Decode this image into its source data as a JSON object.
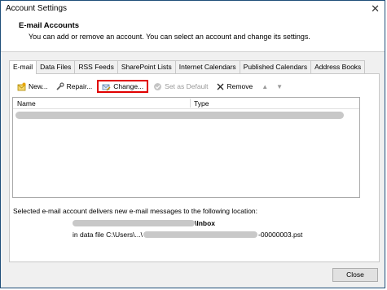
{
  "window": {
    "title": "Account Settings",
    "close_glyph": "✕"
  },
  "header": {
    "title": "E-mail Accounts",
    "subtitle": "You can add or remove an account. You can select an account and change its settings."
  },
  "tabs": [
    {
      "label": "E-mail",
      "active": true
    },
    {
      "label": "Data Files"
    },
    {
      "label": "RSS Feeds"
    },
    {
      "label": "SharePoint Lists"
    },
    {
      "label": "Internet Calendars"
    },
    {
      "label": "Published Calendars"
    },
    {
      "label": "Address Books"
    }
  ],
  "toolbar": {
    "new_label": "New...",
    "repair_label": "Repair...",
    "change_label": "Change...",
    "set_default_label": "Set as Default",
    "remove_label": "Remove"
  },
  "list": {
    "columns": [
      "Name",
      "Type"
    ]
  },
  "delivery": {
    "info": "Selected e-mail account delivers new e-mail messages to the following location:",
    "inbox": "\\Inbox",
    "data_file_prefix": "in data file C:\\Users\\...\\",
    "data_file_suffix": "-00000003.pst"
  },
  "footer": {
    "close_label": "Close"
  },
  "colors": {
    "highlight_border": "#e00000",
    "redacted": "#c8c8c8"
  }
}
